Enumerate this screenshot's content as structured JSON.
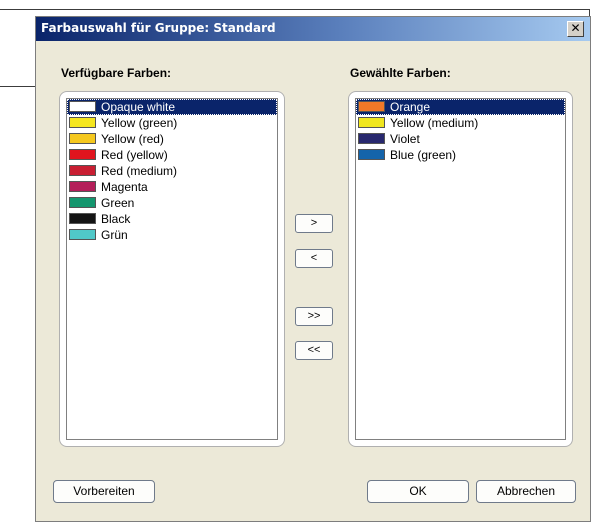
{
  "dialog": {
    "title": "Farbauswahl für Gruppe: Standard",
    "close_glyph": "✕"
  },
  "available": {
    "label": "Verfügbare Farben:",
    "items": [
      {
        "label": "Opaque white",
        "color": "#ffffff",
        "selected": true
      },
      {
        "label": "Yellow (green)",
        "color": "#f5e61e"
      },
      {
        "label": "Yellow (red)",
        "color": "#f5c81e"
      },
      {
        "label": "Red (yellow)",
        "color": "#e0141e"
      },
      {
        "label": "Red (medium)",
        "color": "#c81e32"
      },
      {
        "label": "Magenta",
        "color": "#b41e5a"
      },
      {
        "label": "Green",
        "color": "#14966e"
      },
      {
        "label": "Black",
        "color": "#141414"
      },
      {
        "label": "Grün",
        "color": "#50c8c8"
      }
    ]
  },
  "selected": {
    "label": "Gewählte Farben:",
    "items": [
      {
        "label": "Orange",
        "color": "#f07828",
        "selected": true
      },
      {
        "label": "Yellow (medium)",
        "color": "#f0e61e"
      },
      {
        "label": "Violet",
        "color": "#28286e"
      },
      {
        "label": "Blue (green)",
        "color": "#1464aa"
      }
    ]
  },
  "transfer_buttons": {
    "add": ">",
    "remove": "<",
    "add_all": ">>",
    "remove_all": "<<"
  },
  "footer": {
    "prepare": "Vorbereiten",
    "ok": "OK",
    "cancel": "Abbrechen"
  }
}
